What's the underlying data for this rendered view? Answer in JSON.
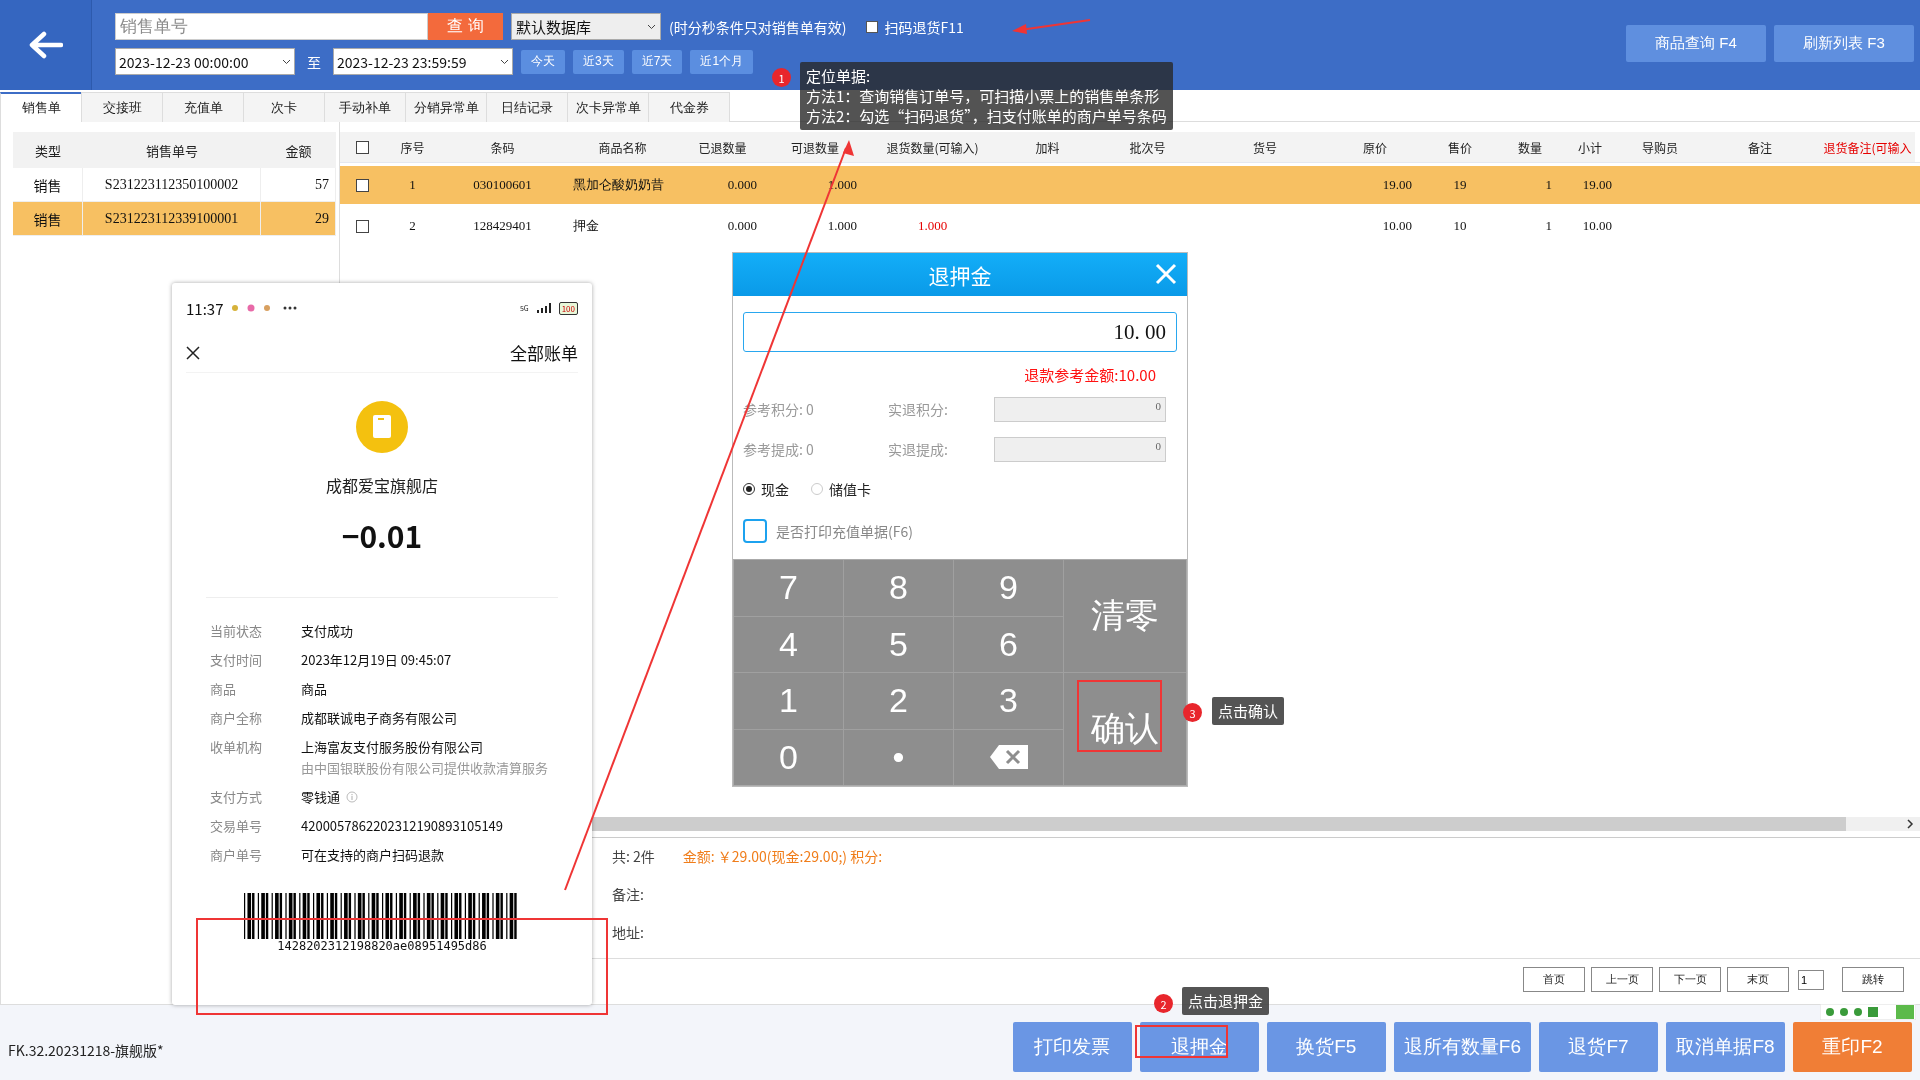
{
  "header": {
    "search": {
      "placeholder": "销售单号"
    },
    "query_button": "查 询",
    "database": {
      "value": "默认数据库"
    },
    "note": "(时分秒条件只对销售单有效)",
    "scan_return": {
      "label": "扫码退货F11",
      "checked": false
    },
    "start_date": "2023-12-23 00:00:00",
    "to_label": "至",
    "end_date": "2023-12-23 23:59:59",
    "quick_ranges": [
      "今天",
      "近3天",
      "近7天",
      "近1个月"
    ],
    "top_buttons": [
      "商品查询 F4",
      "刷新列表 F3"
    ]
  },
  "tabs": [
    {
      "label": "销售单",
      "selected": true
    },
    {
      "label": "交接班",
      "selected": false
    },
    {
      "label": "充值单",
      "selected": false
    },
    {
      "label": "次卡",
      "selected": false
    },
    {
      "label": "手动补单",
      "selected": false
    },
    {
      "label": "分销异常单",
      "selected": false
    },
    {
      "label": "日结记录",
      "selected": false
    },
    {
      "label": "次卡异常单",
      "selected": false
    },
    {
      "label": "代金券",
      "selected": false
    }
  ],
  "orders": {
    "columns": [
      "类型",
      "销售单号",
      "金额"
    ],
    "rows": [
      {
        "type": "销售",
        "number": "S231223112350100002",
        "amount": "57",
        "selected": false
      },
      {
        "type": "销售",
        "number": "S231223112339100001",
        "amount": "29",
        "selected": true
      }
    ]
  },
  "items": {
    "select_all": false,
    "columns": [
      {
        "label": "序号",
        "kind": "plain"
      },
      {
        "label": "条码",
        "kind": "plain"
      },
      {
        "label": "商品名称",
        "kind": "plain"
      },
      {
        "label": "已退数量",
        "kind": "plain"
      },
      {
        "label": "可退数量",
        "kind": "plain"
      },
      {
        "label": "退货数量(可输入)",
        "kind": "plain"
      },
      {
        "label": "加料",
        "kind": "plain"
      },
      {
        "label": "批次号",
        "kind": "plain"
      },
      {
        "label": "货号",
        "kind": "plain"
      },
      {
        "label": "原价",
        "kind": "plain"
      },
      {
        "label": "售价",
        "kind": "plain"
      },
      {
        "label": "数量",
        "kind": "plain"
      },
      {
        "label": "小计",
        "kind": "plain"
      },
      {
        "label": "导购员",
        "kind": "plain"
      },
      {
        "label": "备注",
        "kind": "plain"
      },
      {
        "label": "退货备注(可输入",
        "kind": "editable"
      }
    ],
    "rows": [
      {
        "checked": false,
        "selected": true,
        "index": "1",
        "barcode": "030100601",
        "name": "黑加仑酸奶奶昔",
        "returned": "0.000",
        "returnable": "1.000",
        "price": "19.00",
        "sale_price": "19",
        "qty": "1",
        "subtotal": "19.00"
      },
      {
        "checked": false,
        "selected": false,
        "index": "2",
        "barcode": "128429401",
        "name": "押金",
        "returned": "0.000",
        "returnable": "1.000",
        "return_qty": "1.000",
        "price": "10.00",
        "sale_price": "10",
        "qty": "1",
        "subtotal": "10.00"
      }
    ]
  },
  "summary": {
    "count": "共: 2件",
    "amount": "金额: ￥29.00(现金:29.00;) 积分:",
    "remark_label": "备注:",
    "address_label": "地址:"
  },
  "pager": {
    "buttons": [
      "首页",
      "上一页",
      "下一页",
      "末页"
    ],
    "page": "1",
    "jump": "跳转"
  },
  "footer": {
    "version": "FK.32.20231218-旗舰版*",
    "buttons": [
      {
        "label": "打印发票",
        "kind": "normal"
      },
      {
        "label": "退押金",
        "kind": "normal"
      },
      {
        "label": "换货F5",
        "kind": "normal"
      },
      {
        "label": "退所有数量F6",
        "kind": "normal"
      },
      {
        "label": "退货F7",
        "kind": "normal"
      },
      {
        "label": "取消单据F8",
        "kind": "normal"
      },
      {
        "label": "重印F2",
        "kind": "primary"
      }
    ]
  },
  "phone": {
    "time": "11:37",
    "network": "5G",
    "battery": "100",
    "title": "全部账单",
    "merchant": "成都爱宝旗舰店",
    "amount": "−0.01",
    "details": [
      {
        "label": "当前状态",
        "value": "支付成功"
      },
      {
        "label": "支付时间",
        "value": "2023年12月19日 09:45:07"
      },
      {
        "label": "商品",
        "value": "商品"
      },
      {
        "label": "商户全称",
        "value": "成都联诚电子商务有限公司"
      },
      {
        "label": "收单机构",
        "value": "上海富友支付服务股份有限公司",
        "note": "由中国银联股份有限公司提供收款清算服务"
      },
      {
        "label": "支付方式",
        "value": "零钱通",
        "info": true
      },
      {
        "label": "交易单号",
        "value": "4200057862202312190893105149"
      },
      {
        "label": "商户单号",
        "value": "可在支持的商户扫码退款"
      }
    ],
    "barcode": "1428202312198820ae08951495d86"
  },
  "dialog": {
    "title": "退押金",
    "amount": "10. 00",
    "reference": "退款参考金额:10.00",
    "fields": [
      {
        "label": "参考积分:",
        "value": "0",
        "actual_label": "实退积分:",
        "actual": "0"
      },
      {
        "label": "参考提成:",
        "value": "0",
        "actual_label": "实退提成:",
        "actual": "0"
      }
    ],
    "payment": [
      {
        "label": "现金",
        "selected": true
      },
      {
        "label": "储值卡",
        "selected": false
      }
    ],
    "print_receipt": {
      "label": "是否打印充值单据(F6)",
      "checked": false
    },
    "keys": [
      {
        "kind": "key",
        "label": "7"
      },
      {
        "kind": "key",
        "label": "8"
      },
      {
        "kind": "key",
        "label": "9"
      },
      {
        "kind": "key",
        "label": "4"
      },
      {
        "kind": "key",
        "label": "5"
      },
      {
        "kind": "key",
        "label": "6"
      },
      {
        "kind": "key",
        "label": "1"
      },
      {
        "kind": "key",
        "label": "2"
      },
      {
        "kind": "key",
        "label": "3"
      },
      {
        "kind": "key",
        "label": "0"
      },
      {
        "kind": "key",
        "label": "•"
      },
      {
        "kind": "backspace"
      }
    ],
    "clear": "清零",
    "confirm": "确认"
  },
  "annotations": [
    {
      "number": "1",
      "title": "定位单据:",
      "lines": [
        "方法1：查询销售订单号，可扫描小票上的销售单条形",
        "方法2：勾选“扫码退货”，扫支付账单的商户单号条码"
      ]
    },
    {
      "number": "3",
      "lines": [
        "点击确认"
      ]
    },
    {
      "number": "2",
      "lines": [
        "点击退押金"
      ]
    }
  ]
}
